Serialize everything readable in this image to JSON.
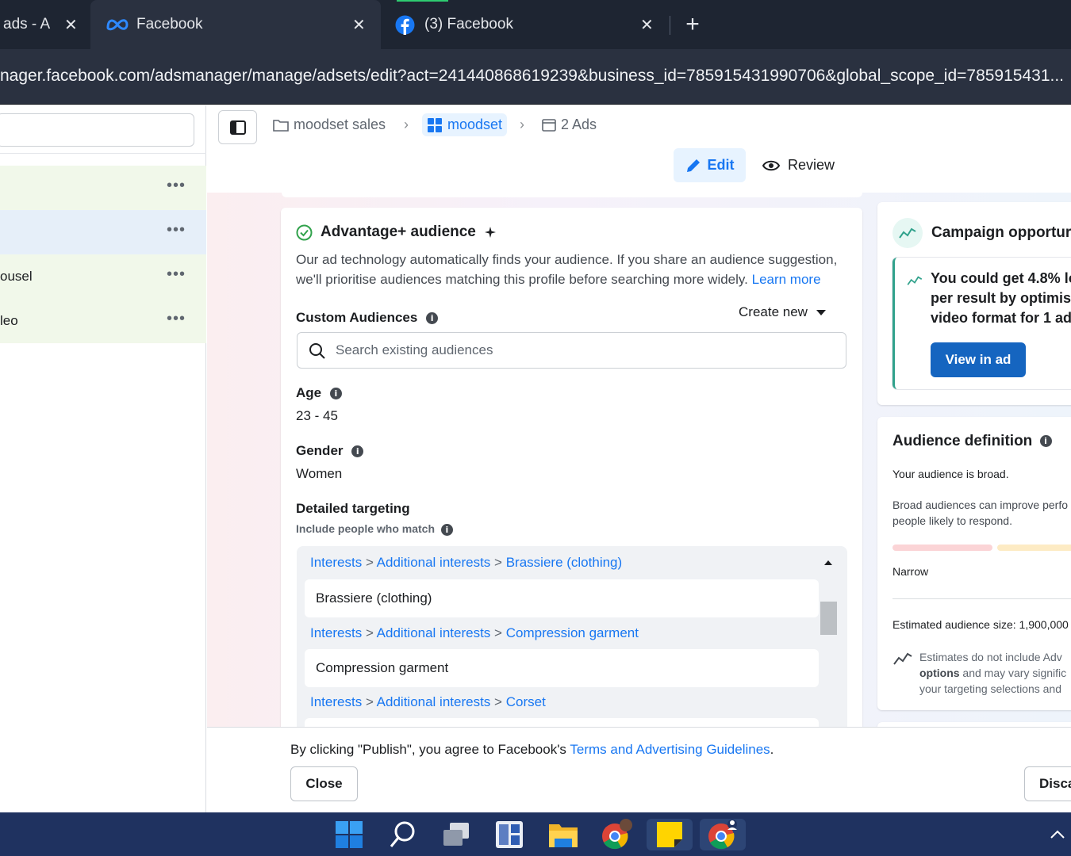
{
  "tabs": [
    {
      "label": "ads - A",
      "close": "✕"
    },
    {
      "label": "Facebook",
      "close": "✕"
    },
    {
      "label": "(3) Facebook",
      "close": "✕"
    }
  ],
  "new_tab": "+",
  "address": {
    "url": "nager.facebook.com/adsmanager/manage/adsets/edit?act=241440868619239&business_id=785915431990706&global_scope_id=785915431..."
  },
  "left_list": [
    {
      "label": ""
    },
    {
      "label": ""
    },
    {
      "label": "ousel"
    },
    {
      "label": "leo"
    }
  ],
  "left_dots": "•••",
  "breadcrumb": {
    "campaign": "moodset sales",
    "adset": "moodset",
    "ads": "2 Ads"
  },
  "mode": {
    "edit": "Edit",
    "review": "Review"
  },
  "audience": {
    "title": "Advantage+ audience",
    "description": "Our ad technology automatically finds your audience. If you share an audience suggestion, we'll prioritise audiences matching this profile before searching more widely.",
    "learn_more": "Learn more",
    "custom_label": "Custom Audiences",
    "create_new": "Create new",
    "search_placeholder": "Search existing audiences",
    "age_label": "Age",
    "age_value": "23 - 45",
    "gender_label": "Gender",
    "gender_value": "Women",
    "detailed_label": "Detailed targeting",
    "include_label": "Include people who match",
    "targeting": [
      {
        "p1": "Interests",
        "p2": "Additional interests",
        "p3": "Brassiere (clothing)",
        "item": "Brassiere (clothing)"
      },
      {
        "p1": "Interests",
        "p2": "Additional interests",
        "p3": "Compression garment",
        "item": "Compression garment"
      },
      {
        "p1": "Interests",
        "p2": "Additional interests",
        "p3": "Corset",
        "item": ""
      }
    ]
  },
  "opportunity": {
    "title": "Campaign opportur",
    "body": [
      "You could get 4.8% lo",
      "per result by optimis",
      "video format for 1 ad"
    ],
    "button": "View in ad"
  },
  "definition": {
    "title": "Audience definition",
    "broad": "Your audience is broad.",
    "improve": [
      "Broad audiences can improve perfo",
      "people likely to respond."
    ],
    "narrow": "Narrow",
    "size": "Estimated audience size: 1,900,000",
    "note_1": "Estimates do not include Adv",
    "note_2_bold": "options",
    "note_2_rest": " and may vary signific",
    "note_3": "your targeting selections and"
  },
  "footer": {
    "prefix": "By clicking \"Publish\", you agree to Facebook's ",
    "link": "Terms and Advertising Guidelines",
    "suffix": ".",
    "close": "Close",
    "discard": "Disca"
  },
  "colors": {
    "accent": "#1877f2",
    "publish_button": "#1565c0",
    "tab_bg": "#1e2532",
    "taskbar": "#1f3260"
  }
}
